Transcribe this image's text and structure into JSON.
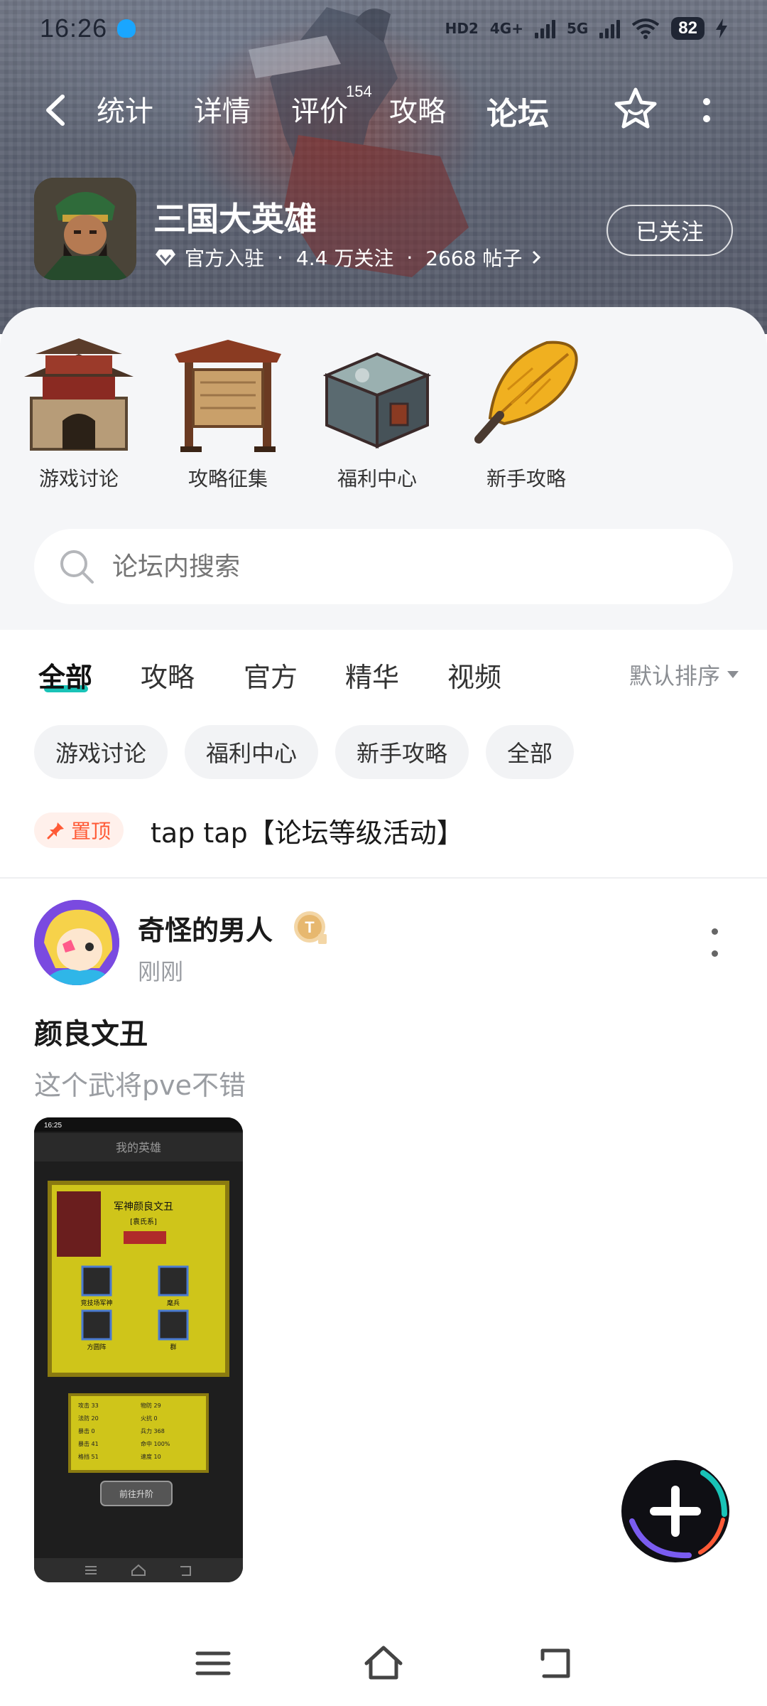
{
  "status_bar": {
    "time": "16:26",
    "network_labels": [
      "HD2",
      "4G+",
      "5G"
    ],
    "battery": "82"
  },
  "nav": {
    "tabs": [
      {
        "label": "统计"
      },
      {
        "label": "详情"
      },
      {
        "label": "评价"
      },
      {
        "label": "攻略"
      },
      {
        "label": "论坛"
      }
    ],
    "review_count": "154",
    "active_tab": "论坛"
  },
  "game": {
    "title": "三国大英雄",
    "official": "官方入驻",
    "followers": "4.4 万关注",
    "posts": "2668 帖子",
    "dot": "·",
    "follow_label": "已关注"
  },
  "quick_links": [
    {
      "label": "游戏讨论"
    },
    {
      "label": "攻略征集"
    },
    {
      "label": "福利中心"
    },
    {
      "label": "新手攻略"
    }
  ],
  "search": {
    "placeholder": "论坛内搜索"
  },
  "filter_tabs": [
    {
      "label": "全部"
    },
    {
      "label": "攻略"
    },
    {
      "label": "官方"
    },
    {
      "label": "精华"
    },
    {
      "label": "视频"
    }
  ],
  "sort": {
    "label": "默认排序"
  },
  "chips": [
    {
      "label": "游戏讨论"
    },
    {
      "label": "福利中心"
    },
    {
      "label": "新手攻略"
    },
    {
      "label": "全部"
    }
  ],
  "pinned": {
    "badge": "置顶",
    "title": "tap tap【论坛等级活动】"
  },
  "post": {
    "author": "奇怪的男人",
    "time": "刚刚",
    "title": "颜良文丑",
    "excerpt": "这个武将pve不错",
    "level_badge": "T"
  },
  "screenshot_preview": {
    "time": "16:25",
    "heading": "我的英雄",
    "hero_name": "军神颜良文丑",
    "faction": "[袁氏系]",
    "skills": [
      "竞技场军神",
      "麾兵",
      "方圆阵",
      "群"
    ],
    "stats": [
      "攻击 33",
      "物防 29",
      "法防 20",
      "火抗 0",
      "暴击 0",
      "兵力 368",
      "暴击 41",
      "命中 100%",
      "格挡 51",
      "速度 10"
    ],
    "button": "前往升阶"
  },
  "colors": {
    "accent": "#19c3b7",
    "pin": "#ff5a36",
    "muted": "#9a9da2"
  },
  "icons": [
    "back-chevron-icon",
    "star-icon",
    "more-vertical-icon",
    "diamond-icon",
    "chevron-right-icon",
    "search-icon",
    "pin-icon",
    "plus-icon",
    "menu-icon",
    "home-icon",
    "back-icon"
  ]
}
